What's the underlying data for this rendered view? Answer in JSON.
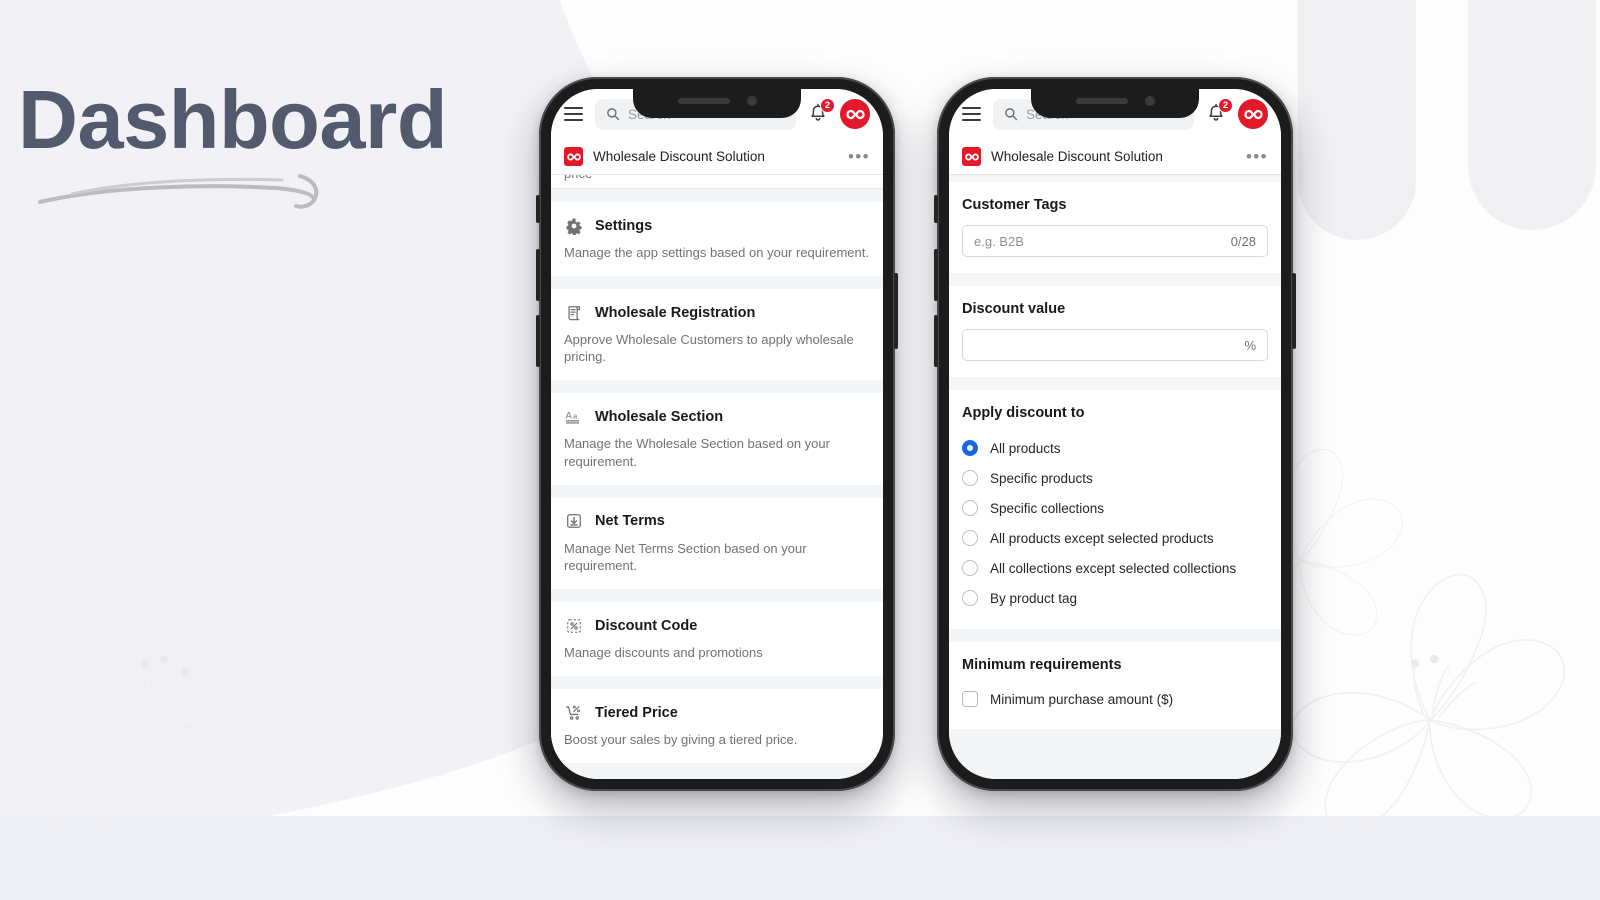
{
  "page": {
    "heading": "Dashboard",
    "accent_red": "#e3192b",
    "heading_color": "#545a6e",
    "radio_accent": "#1769e0",
    "background_color": "#f1f1f6"
  },
  "app_chrome": {
    "menu_icon": "hamburger-menu-icon",
    "search": {
      "icon": "search-icon",
      "placeholder": "Search",
      "value": ""
    },
    "notifications": {
      "icon": "bell-icon",
      "badge_count": "2"
    },
    "avatar_icon": "infinity-logo-icon",
    "appbar": {
      "tile_icon": "infinity-logo-icon",
      "title": "Wholesale Discount Solution",
      "overflow_label": "•••"
    }
  },
  "phone_left": {
    "clipped_text": "price",
    "cards": [
      {
        "icon": "gear-icon",
        "title": "Settings",
        "desc": "Manage the app settings based on your requirement."
      },
      {
        "icon": "scroll-document-icon",
        "title": "Wholesale Registration",
        "desc": "Approve Wholesale Customers to apply wholesale pricing."
      },
      {
        "icon": "typography-aa-icon",
        "title": "Wholesale Section",
        "desc": "Manage the Wholesale Section based on your requirement."
      },
      {
        "icon": "import-download-icon",
        "title": "Net Terms",
        "desc": "Manage Net Terms Section based on your requirement."
      },
      {
        "icon": "discount-percent-icon",
        "title": "Discount Code",
        "desc": "Manage discounts and promotions"
      },
      {
        "icon": "cart-percent-icon",
        "title": "Tiered Price",
        "desc": "Boost your sales by giving a tiered price."
      }
    ]
  },
  "phone_right": {
    "customer_tags": {
      "title": "Customer Tags",
      "placeholder": "e.g. B2B",
      "value": "",
      "counter": "0/28"
    },
    "discount_value": {
      "title": "Discount value",
      "value": "",
      "suffix": "%"
    },
    "apply_discount": {
      "title": "Apply discount to",
      "selected_index": 0,
      "options": [
        {
          "label": "All products",
          "selected": true
        },
        {
          "label": "Specific products",
          "selected": false
        },
        {
          "label": "Specific collections",
          "selected": false
        },
        {
          "label": "All products except selected products",
          "selected": false
        },
        {
          "label": "All collections except selected collections",
          "selected": false
        },
        {
          "label": "By product tag",
          "selected": false
        }
      ]
    },
    "minimum_requirements": {
      "title": "Minimum requirements",
      "options": [
        {
          "label": "Minimum purchase amount ($)",
          "checked": false
        }
      ]
    }
  }
}
